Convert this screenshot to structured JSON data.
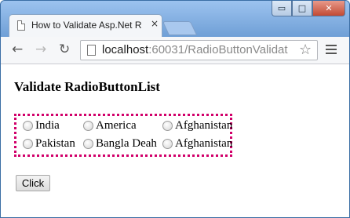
{
  "browser": {
    "tab_title": "How to Validate Asp.Net R",
    "tab_close": "×",
    "url_host": "localhost",
    "url_rest": ":60031/RadioButtonValidat",
    "window_buttons": {
      "minimize": "▭",
      "maximize": "□",
      "close": "✕"
    }
  },
  "page": {
    "heading": "Validate RadioButtonList",
    "options": [
      {
        "label": "India"
      },
      {
        "label": "America"
      },
      {
        "label": "Afghanistan"
      },
      {
        "label": "Pakistan"
      },
      {
        "label": "Bangla Deah"
      },
      {
        "label": "Afghanistan"
      }
    ],
    "button_label": "Click"
  },
  "colors": {
    "validation_border": "#d1006a",
    "window_frame": "#6f9fd6"
  },
  "icons": [
    "page-icon",
    "close-icon",
    "back-arrow-icon",
    "forward-arrow-icon",
    "reload-icon",
    "star-icon",
    "menu-icon"
  ]
}
